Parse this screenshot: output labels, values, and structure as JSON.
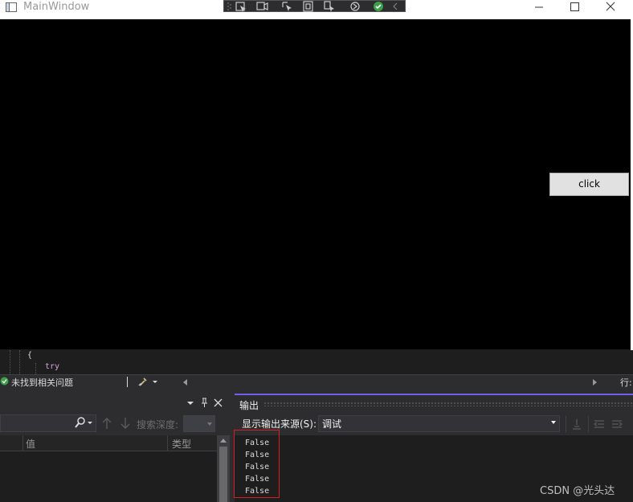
{
  "window": {
    "title": "MainWindow",
    "controls": [
      "minimize",
      "maximize",
      "close"
    ]
  },
  "debug_toolbar": {
    "icons": [
      "select-element-icon",
      "record-icon",
      "pointer-icon",
      "rectangle-icon",
      "display-adorner-icon",
      "hot-reload-icon",
      "track-focus-icon",
      "collapse-icon"
    ]
  },
  "main": {
    "button_label": "click"
  },
  "editor": {
    "line1": "{",
    "line2": "try"
  },
  "status": {
    "issues": "未找到相关问题",
    "line_label": "行:"
  },
  "locals": {
    "search_depth_label": "搜索深度:",
    "col_value": "值",
    "col_type": "类型"
  },
  "output": {
    "title": "输出",
    "source_label": "显示输出来源(S):",
    "source_value": "调试",
    "lines": [
      "False",
      "False",
      "False",
      "False",
      "False"
    ]
  },
  "watermark": "CSDN @光头达",
  "colors": {
    "accent": "#7160e8",
    "highlight": "#d42020",
    "status_ok": "#3ca04a"
  }
}
